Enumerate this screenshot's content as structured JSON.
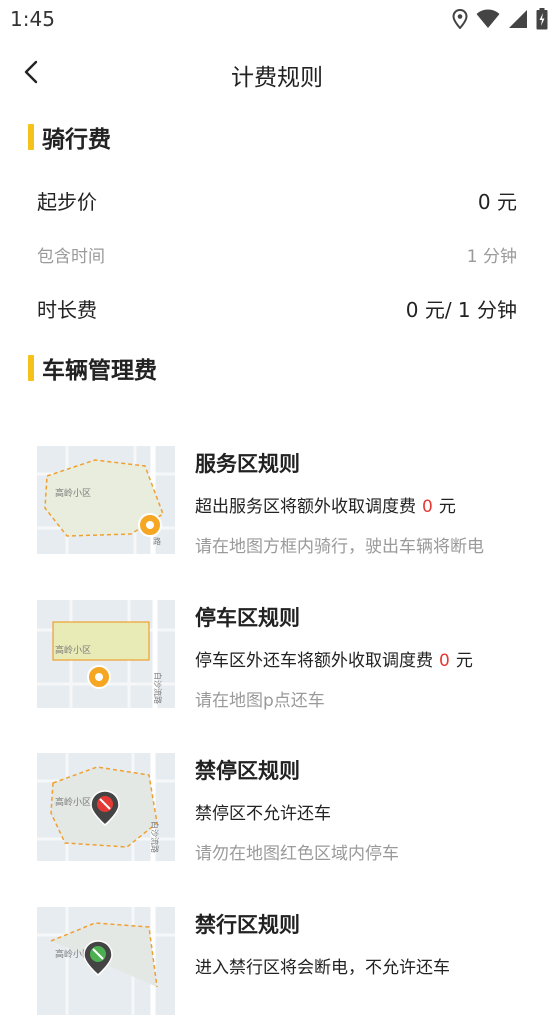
{
  "status_bar": {
    "time": "1:45"
  },
  "header": {
    "title": "计费规则"
  },
  "riding_fee": {
    "title": "骑行费",
    "start_price": {
      "label": "起步价",
      "value": "0 元"
    },
    "included_time": {
      "label": "包含时间",
      "value": "1 分钟"
    },
    "duration_fee": {
      "label": "时长费",
      "value": "0 元/ 1 分钟"
    }
  },
  "vehicle_fee": {
    "title": "车辆管理费",
    "map_label": "高岭小区",
    "road_label": "白沙流路",
    "rules": [
      {
        "title": "服务区规则",
        "desc_prefix": "超出服务区将额外收取调度费",
        "amount": "0",
        "desc_suffix": "元",
        "hint": "请在地图方框内骑行，驶出车辆将断电"
      },
      {
        "title": "停车区规则",
        "desc_prefix": "停车区外还车将额外收取调度费",
        "amount": "0",
        "desc_suffix": "元",
        "hint": "请在地图p点还车"
      },
      {
        "title": "禁停区规则",
        "desc": "禁停区不允许还车",
        "hint": "请勿在地图红色区域内停车"
      },
      {
        "title": "禁行区规则",
        "desc": "进入禁行区将会断电，不允许还车"
      }
    ]
  },
  "colors": {
    "accent": "#f5c21b",
    "amount_red": "#e53935",
    "zone_border": "#f0a030",
    "parking_fill": "#e8ebb5"
  }
}
